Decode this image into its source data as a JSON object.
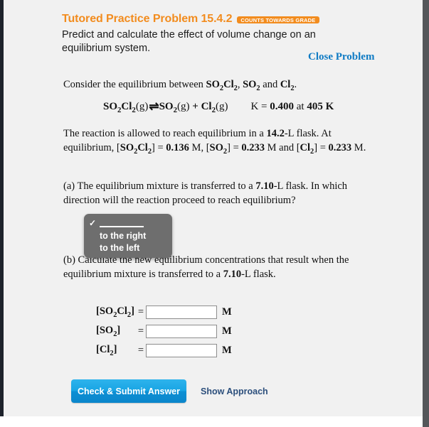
{
  "header": {
    "title": "Tutored Practice Problem 15.4.2",
    "grade_badge": "COUNTS TOWARDS GRADE",
    "subtitle": "Predict and calculate the effect of volume change on an equilibrium system.",
    "close_link": "Close Problem"
  },
  "intro": {
    "consider_prefix": "Consider the equilibrium between ",
    "species_1": "SO",
    "species_1_sub": "2",
    "species_1_b": "Cl",
    "species_1_sub_b": "2",
    "species_2": "SO",
    "species_2_sub": "2",
    "conjunction": " and ",
    "species_3": "Cl",
    "species_3_sub": "2",
    "period": "."
  },
  "equation": {
    "reactant": "SO",
    "reactant_sub1": "2",
    "reactant_el2": "Cl",
    "reactant_sub2": "2",
    "reactant_state": "(g)",
    "arrow": "⇌",
    "product_1": "SO",
    "product_1_sub": "2",
    "product_1_state": "(g)",
    "plus": " + ",
    "product_2": "Cl",
    "product_2_sub": "2",
    "product_2_state": "(g)",
    "k_label": "K = ",
    "k_value": "0.400",
    "at_word": " at ",
    "temperature": "405 K"
  },
  "equilibrium_statement": {
    "text_1": "The reaction is allowed to reach equilibrium in a ",
    "volume_initial": "14.2",
    "text_2": "-L flask. At equilibrium, [",
    "conc_1_species": "SO2Cl2",
    "conc_1_value": "0.136",
    "conc_2_species": "SO2",
    "conc_2_value": "0.233",
    "conc_3_species": "Cl2",
    "conc_3_value": "0.233",
    "unit": "M"
  },
  "part_a": {
    "text_1": "(a) The equilibrium mixture is transferred to a ",
    "volume_new": "7.10",
    "text_2": "-L flask. In which direction will the reaction proceed to reach equilibrium?"
  },
  "direction_dropdown": {
    "expanded": true,
    "checkmark": "✓",
    "options": [
      {
        "label": "",
        "blank": true,
        "selected": true
      },
      {
        "label": "to the right",
        "blank": false,
        "selected": false
      },
      {
        "label": "to the left",
        "blank": false,
        "selected": false
      }
    ]
  },
  "part_b": {
    "text_1": "(b) Calculate the new equilibrium concentrations that result when the equilibrium mixture is transferred to a ",
    "volume_new": "7.10",
    "text_2": "-L flask."
  },
  "answers": {
    "unit": "M",
    "equals": "=",
    "rows": [
      {
        "species": "SO",
        "sub1": "2",
        "el2": "Cl",
        "sub2": "2",
        "value": "",
        "placeholder": ""
      },
      {
        "species": "SO",
        "sub1": "2",
        "el2": "",
        "sub2": "",
        "value": "",
        "placeholder": ""
      },
      {
        "species": "Cl",
        "sub1": "2",
        "el2": "",
        "sub2": "",
        "value": "",
        "placeholder": ""
      }
    ]
  },
  "footer": {
    "submit_label": "Check & Submit Answer",
    "show_approach_label": "Show Approach"
  },
  "colors": {
    "accent_orange": "#f28c1e",
    "link_blue": "#0f7bc4",
    "button_blue": "#19a5e4",
    "approach_navy": "#2c4f7c",
    "dropdown_gray": "#6e6e6e",
    "page_bg": "#f1f1f1",
    "rail_dark": "#1d222b"
  }
}
